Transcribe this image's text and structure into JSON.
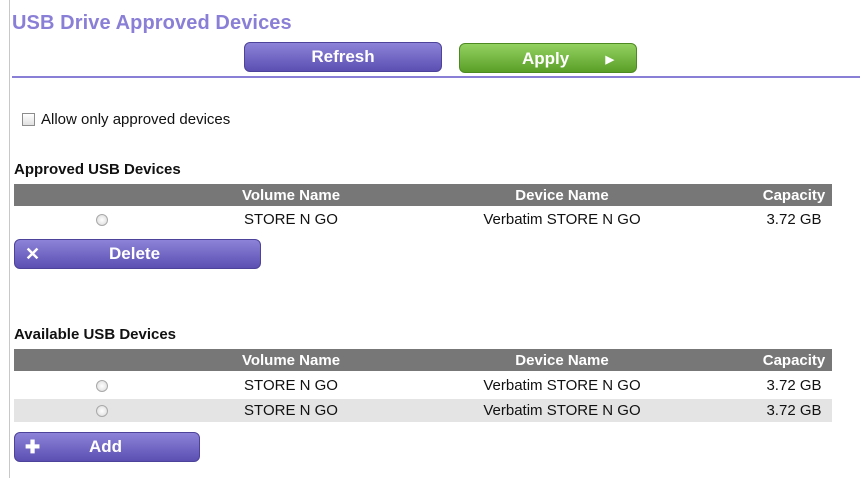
{
  "page": {
    "title": "USB Drive Approved Devices"
  },
  "toolbar": {
    "refresh_label": "Refresh",
    "apply_label": "Apply",
    "apply_icon": "play-arrow-icon"
  },
  "settings": {
    "allow_only_approved_label": "Allow only approved devices",
    "allow_only_approved_checked": false
  },
  "approved": {
    "title": "Approved USB Devices",
    "columns": [
      "Volume Name",
      "Device Name",
      "Capacity"
    ],
    "rows": [
      {
        "volume": "STORE N GO",
        "device": "Verbatim STORE N GO",
        "capacity": "3.72 GB"
      }
    ],
    "delete_label": "Delete",
    "delete_icon": "x-icon"
  },
  "available": {
    "title": "Available USB Devices",
    "columns": [
      "Volume Name",
      "Device Name",
      "Capacity"
    ],
    "rows": [
      {
        "volume": "STORE N GO",
        "device": "Verbatim STORE N GO",
        "capacity": "3.72 GB"
      },
      {
        "volume": "STORE N GO",
        "device": "Verbatim STORE N GO",
        "capacity": "3.72 GB"
      }
    ],
    "add_label": "Add",
    "add_icon": "plus-icon"
  },
  "colors": {
    "accent_purple": "#8a7fd6",
    "button_purple": "#5b4fb2",
    "button_green": "#5a9e27",
    "table_header": "#777777",
    "row_alt": "#e4e4e4"
  }
}
